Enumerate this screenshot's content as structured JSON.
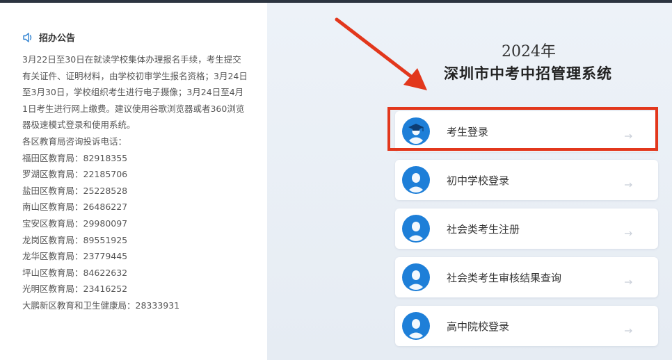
{
  "notice": {
    "title": "招办公告",
    "paragraph": "3月22日至30日在就读学校集体办理报名手续，考生提交有关证件、证明材料，由学校初审学生报名资格；3月24日至3月30日，学校组织考生进行电子摄像；3月24日至4月1日考生进行网上缴费。建议使用谷歌浏览器或者360浏览器极速模式登录和使用系统。",
    "hotline_title": "各区教育局咨询投诉电话：",
    "hotlines": [
      {
        "name": "福田区教育局：",
        "phone": "82918355"
      },
      {
        "name": "罗湖区教育局：",
        "phone": "22185706"
      },
      {
        "name": "盐田区教育局：",
        "phone": "25228528"
      },
      {
        "name": "南山区教育局：",
        "phone": "26486227"
      },
      {
        "name": "宝安区教育局：",
        "phone": "29980097"
      },
      {
        "name": "龙岗区教育局：",
        "phone": "89551925"
      },
      {
        "name": "龙华区教育局：",
        "phone": "23779445"
      },
      {
        "name": "坪山区教育局：",
        "phone": "84622632"
      },
      {
        "name": "光明区教育局：",
        "phone": "23416252"
      },
      {
        "name": "大鹏新区教育和卫生健康局：",
        "phone": "28333931"
      }
    ]
  },
  "header": {
    "year": "2024年",
    "system_title": "深圳市中考中招管理系统"
  },
  "login_options": [
    {
      "label": "考生登录",
      "icon": "graduate-cap-avatar-icon"
    },
    {
      "label": "初中学校登录",
      "icon": "person-avatar-icon"
    },
    {
      "label": "社会类考生注册",
      "icon": "person-avatar-icon"
    },
    {
      "label": "社会类考生审核结果查询",
      "icon": "person-avatar-icon"
    },
    {
      "label": "高中院校登录",
      "icon": "person-avatar-icon"
    }
  ],
  "colors": {
    "annotation_red": "#e2371c",
    "avatar_blue": "#1e7fd8",
    "background": "#e9eef5"
  }
}
